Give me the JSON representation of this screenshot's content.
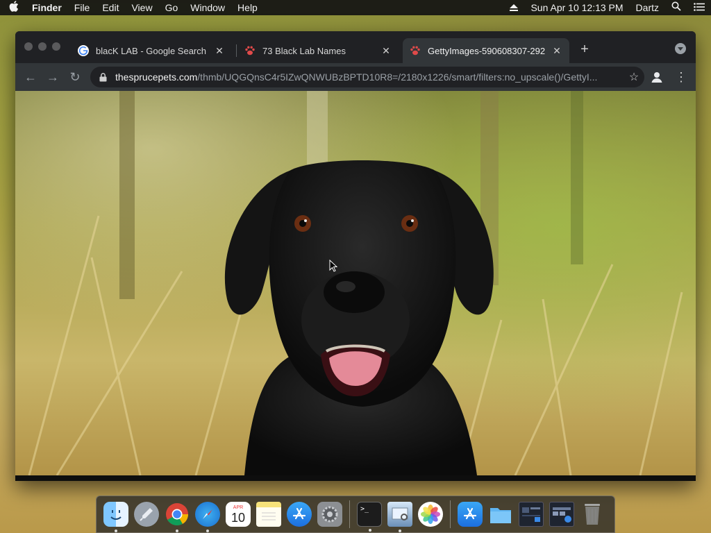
{
  "menubar": {
    "app_name": "Finder",
    "items": [
      "File",
      "Edit",
      "View",
      "Go",
      "Window",
      "Help"
    ],
    "datetime": "Sun Apr 10  12:13 PM",
    "user": "Dartz"
  },
  "browser": {
    "tabs": [
      {
        "title": "blacK LAB - Google Search",
        "icon": "google-icon",
        "active": false
      },
      {
        "title": "73 Black Lab Names",
        "icon": "paw-icon",
        "active": false
      },
      {
        "title": "GettyImages-590608307-292",
        "icon": "paw-icon",
        "active": true
      }
    ],
    "url_host": "thesprucepets.com",
    "url_path": "/thmb/UQGQnsC4r5IZwQNWUBzBPTD10R8=/2180x1226/smart/filters:no_upscale()/GettyI..."
  },
  "dock": {
    "calendar_month": "APR",
    "calendar_day": "10",
    "apps": [
      "finder-icon",
      "launchpad-icon",
      "chrome-icon",
      "safari-icon",
      "calendar-icon",
      "notes-icon",
      "app-store-icon",
      "system-preferences-icon",
      "terminal-icon",
      "preview-icon",
      "photos-icon",
      "app-store-folder-icon",
      "documents-folder-icon",
      "screenshot-icon",
      "screenshot-icon-2",
      "trash-icon"
    ]
  },
  "colors": {
    "chrome_dark": "#202124",
    "chrome_toolbar": "#323639"
  }
}
